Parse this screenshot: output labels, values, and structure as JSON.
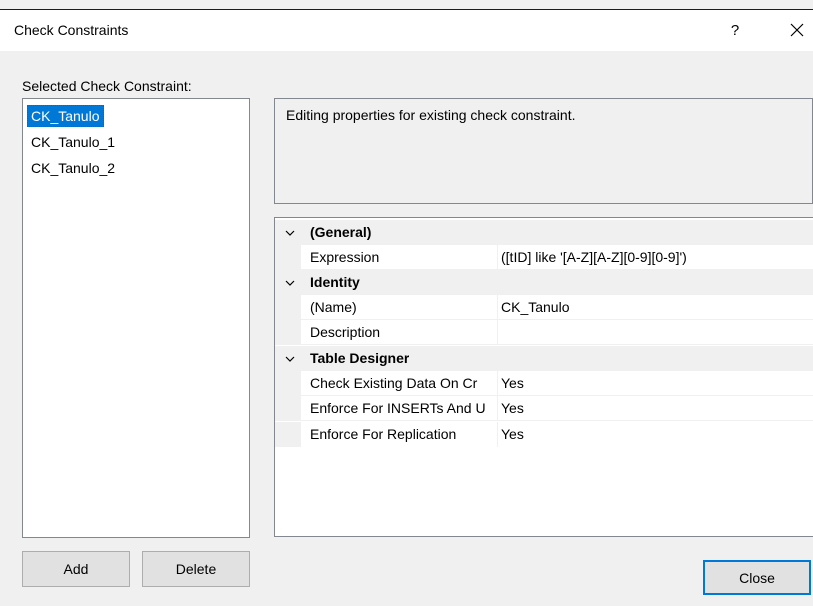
{
  "window": {
    "title": "Check Constraints",
    "help_label": "?"
  },
  "left": {
    "label": "Selected Check Constraint:",
    "items": [
      {
        "label": "CK_Tanulo",
        "selected": true
      },
      {
        "label": "CK_Tanulo_1",
        "selected": false
      },
      {
        "label": "CK_Tanulo_2",
        "selected": false
      }
    ]
  },
  "description": "Editing properties for existing check constraint.",
  "grid": {
    "categories": [
      {
        "name": "(General)",
        "props": [
          {
            "name": "Expression",
            "value": "([tID] like '[A-Z][A-Z][0-9][0-9]')"
          }
        ]
      },
      {
        "name": "Identity",
        "props": [
          {
            "name": "(Name)",
            "value": "CK_Tanulo"
          },
          {
            "name": "Description",
            "value": ""
          }
        ]
      },
      {
        "name": "Table Designer",
        "props": [
          {
            "name": "Check Existing Data On Cr",
            "value": "Yes"
          },
          {
            "name": "Enforce For INSERTs And U",
            "value": "Yes"
          },
          {
            "name": "Enforce For Replication",
            "value": "Yes"
          }
        ]
      }
    ]
  },
  "buttons": {
    "add": "Add",
    "delete": "Delete",
    "close": "Close"
  },
  "icons": {
    "close": "close-icon",
    "expand": "chevron-down-icon"
  },
  "colors": {
    "selection": "#0078d7",
    "titlebar": "#ffffff",
    "dialog": "#f0f0f0"
  }
}
